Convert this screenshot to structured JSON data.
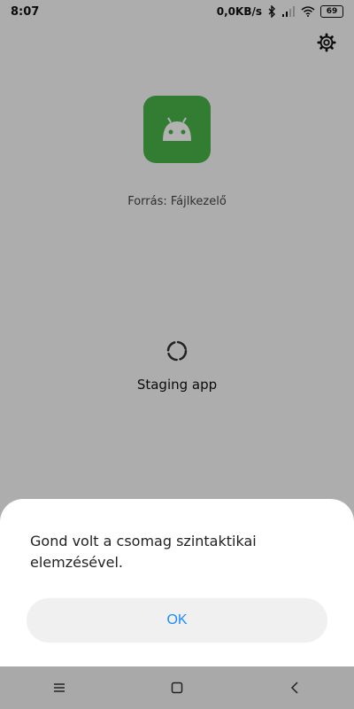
{
  "status_bar": {
    "time": "8:07",
    "network_speed": "0,0KB/s",
    "battery": "69",
    "icons": [
      "bluetooth-icon",
      "signal-icon",
      "wifi-icon",
      "battery-icon"
    ]
  },
  "installer": {
    "source_label": "Forrás: Fájlkezelő",
    "status_text": "Staging app",
    "icons": [
      "settings-icon",
      "android-app-icon",
      "loading-spinner-icon"
    ]
  },
  "dialog": {
    "message": "Gond volt a csomag szintaktikai elemzésével.",
    "ok_label": "OK",
    "accent_color": "#1a8cff"
  },
  "nav": {
    "icons": [
      "menu-icon",
      "home-icon",
      "back-icon"
    ]
  },
  "colors": {
    "app_icon_bg": "#49b34a"
  }
}
